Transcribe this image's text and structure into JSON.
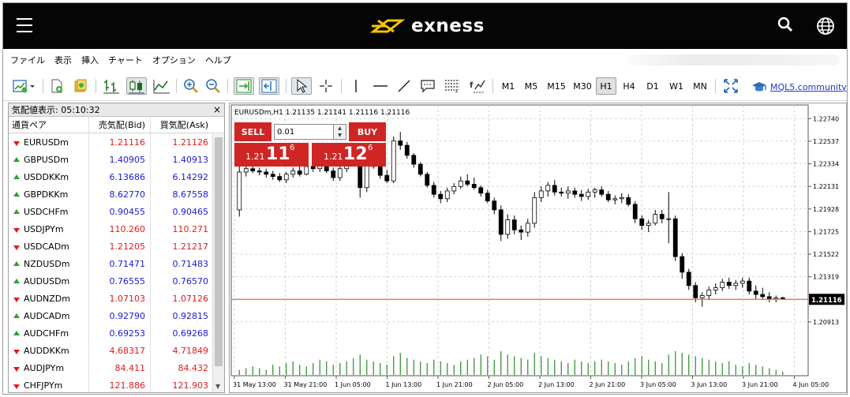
{
  "brand": {
    "name": "exness",
    "logo_color": "#f5c400"
  },
  "menu": [
    "ファイル",
    "表示",
    "挿入",
    "チャート",
    "オプション",
    "ヘルプ"
  ],
  "toolbar": {
    "timeframes": [
      "M1",
      "M5",
      "M15",
      "M30",
      "H1",
      "H4",
      "D1",
      "W1",
      "MN"
    ],
    "active_timeframe": "H1",
    "community_label": "MQL5.community"
  },
  "market_watch": {
    "title": "気配値表示: 05:10:32",
    "columns": {
      "symbol": "通貨ペア",
      "bid": "売気配(Bid)",
      "ask": "買気配(Ask)"
    },
    "rows": [
      {
        "symbol": "EURUSDm",
        "bid": "1.21116",
        "ask": "1.21126",
        "dir": "down"
      },
      {
        "symbol": "GBPUSDm",
        "bid": "1.40905",
        "ask": "1.40913",
        "dir": "up"
      },
      {
        "symbol": "USDDKKm",
        "bid": "6.13686",
        "ask": "6.14292",
        "dir": "up"
      },
      {
        "symbol": "GBPDKKm",
        "bid": "8.62770",
        "ask": "8.67558",
        "dir": "up"
      },
      {
        "symbol": "USDCHFm",
        "bid": "0.90455",
        "ask": "0.90465",
        "dir": "up"
      },
      {
        "symbol": "USDJPYm",
        "bid": "110.260",
        "ask": "110.271",
        "dir": "down"
      },
      {
        "symbol": "USDCADm",
        "bid": "1.21205",
        "ask": "1.21217",
        "dir": "down"
      },
      {
        "symbol": "NZDUSDm",
        "bid": "0.71471",
        "ask": "0.71483",
        "dir": "up"
      },
      {
        "symbol": "AUDUSDm",
        "bid": "0.76555",
        "ask": "0.76570",
        "dir": "up"
      },
      {
        "symbol": "AUDNZDm",
        "bid": "1.07103",
        "ask": "1.07126",
        "dir": "down"
      },
      {
        "symbol": "AUDCADm",
        "bid": "0.92790",
        "ask": "0.92815",
        "dir": "up"
      },
      {
        "symbol": "AUDCHFm",
        "bid": "0.69253",
        "ask": "0.69268",
        "dir": "up"
      },
      {
        "symbol": "AUDDKKm",
        "bid": "4.68317",
        "ask": "4.71849",
        "dir": "down"
      },
      {
        "symbol": "AUDJPYm",
        "bid": "84.411",
        "ask": "84.432",
        "dir": "down"
      },
      {
        "symbol": "CHFJPYm",
        "bid": "121.886",
        "ask": "121.903",
        "dir": "down"
      }
    ]
  },
  "trade_panel": {
    "sell_label": "SELL",
    "buy_label": "BUY",
    "lot": "0.01",
    "sell_price": {
      "prefix": "1.21",
      "big": "11",
      "sup": "6"
    },
    "buy_price": {
      "prefix": "1.21",
      "big": "12",
      "sup": "6"
    }
  },
  "chart_data": {
    "type": "candlestick",
    "title": "EURUSDm,H1  1.21135 1.21141 1.21116 1.21116",
    "current_price": 1.21116,
    "current_price_label": "1.21116",
    "ylim": [
      1.2082,
      1.2282
    ],
    "y_ticks": [
      "1.22740",
      "1.22537",
      "1.22334",
      "1.22131",
      "1.21928",
      "1.21725",
      "1.21522",
      "1.21319",
      "1.20913"
    ],
    "x_ticks": [
      "31 May 13:00",
      "31 May 21:00",
      "1 Jun 05:00",
      "1 Jun 13:00",
      "1 Jun 21:00",
      "2 Jun 05:00",
      "2 Jun 13:00",
      "2 Jun 21:00",
      "3 Jun 05:00",
      "3 Jun 13:00",
      "3 Jun 21:00",
      "4 Jun 05:00"
    ],
    "colors": {
      "bull": "#ffffff",
      "bear": "#000000",
      "wick": "#000000",
      "volume": "#2a8a2a",
      "price_line": "#e87a3c",
      "grid": "#c8c8c8"
    },
    "ohlc": [
      [
        1.2192,
        1.2235,
        1.2186,
        1.2226
      ],
      [
        1.2226,
        1.2232,
        1.2222,
        1.2229
      ],
      [
        1.2229,
        1.2231,
        1.2225,
        1.2227
      ],
      [
        1.2227,
        1.223,
        1.2223,
        1.2226
      ],
      [
        1.2226,
        1.2229,
        1.2221,
        1.2224
      ],
      [
        1.2224,
        1.2227,
        1.2219,
        1.2222
      ],
      [
        1.2222,
        1.2225,
        1.2217,
        1.2219
      ],
      [
        1.2219,
        1.2226,
        1.2216,
        1.2224
      ],
      [
        1.2224,
        1.223,
        1.2221,
        1.2227
      ],
      [
        1.2227,
        1.2231,
        1.2222,
        1.2224
      ],
      [
        1.2224,
        1.2233,
        1.2223,
        1.2231
      ],
      [
        1.2231,
        1.2234,
        1.2226,
        1.2229
      ],
      [
        1.2229,
        1.2234,
        1.2226,
        1.2232
      ],
      [
        1.2232,
        1.2234,
        1.2225,
        1.2227
      ],
      [
        1.2227,
        1.223,
        1.2218,
        1.2221
      ],
      [
        1.2221,
        1.2232,
        1.2218,
        1.2229
      ],
      [
        1.2229,
        1.224,
        1.2226,
        1.2237
      ],
      [
        1.2237,
        1.2245,
        1.2232,
        1.2235
      ],
      [
        1.2235,
        1.2241,
        1.2203,
        1.2212
      ],
      [
        1.2212,
        1.224,
        1.2208,
        1.2237
      ],
      [
        1.2237,
        1.2248,
        1.2229,
        1.2231
      ],
      [
        1.2231,
        1.2236,
        1.222,
        1.2223
      ],
      [
        1.2223,
        1.2228,
        1.2216,
        1.2218
      ],
      [
        1.2218,
        1.2258,
        1.2216,
        1.2254
      ],
      [
        1.2254,
        1.2262,
        1.2246,
        1.225
      ],
      [
        1.225,
        1.2253,
        1.2238,
        1.2241
      ],
      [
        1.2241,
        1.2243,
        1.223,
        1.2233
      ],
      [
        1.2233,
        1.2235,
        1.2222,
        1.2224
      ],
      [
        1.2224,
        1.2226,
        1.2212,
        1.2214
      ],
      [
        1.2214,
        1.2217,
        1.2203,
        1.2206
      ],
      [
        1.2206,
        1.2209,
        1.2198,
        1.2202
      ],
      [
        1.2202,
        1.2212,
        1.2199,
        1.2209
      ],
      [
        1.2209,
        1.2216,
        1.2206,
        1.2213
      ],
      [
        1.2213,
        1.2222,
        1.2211,
        1.2218
      ],
      [
        1.2218,
        1.2224,
        1.2213,
        1.2215
      ],
      [
        1.2215,
        1.2221,
        1.221,
        1.2212
      ],
      [
        1.2212,
        1.2214,
        1.2204,
        1.2207
      ],
      [
        1.2207,
        1.221,
        1.2198,
        1.22
      ],
      [
        1.22,
        1.2203,
        1.2188,
        1.2192
      ],
      [
        1.2192,
        1.2196,
        1.2164,
        1.217
      ],
      [
        1.217,
        1.2188,
        1.2166,
        1.2183
      ],
      [
        1.2183,
        1.2187,
        1.217,
        1.2174
      ],
      [
        1.2174,
        1.2178,
        1.2165,
        1.2172
      ],
      [
        1.2172,
        1.2184,
        1.2168,
        1.218
      ],
      [
        1.218,
        1.2208,
        1.2176,
        1.2203
      ],
      [
        1.2203,
        1.2213,
        1.2199,
        1.2209
      ],
      [
        1.2209,
        1.2217,
        1.2204,
        1.2214
      ],
      [
        1.2214,
        1.2219,
        1.2205,
        1.2208
      ],
      [
        1.2208,
        1.2212,
        1.2204,
        1.2207
      ],
      [
        1.2207,
        1.2213,
        1.2202,
        1.2209
      ],
      [
        1.2209,
        1.2212,
        1.2203,
        1.2206
      ],
      [
        1.2206,
        1.221,
        1.22,
        1.2204
      ],
      [
        1.2204,
        1.2211,
        1.2201,
        1.2208
      ],
      [
        1.2208,
        1.2212,
        1.2203,
        1.221
      ],
      [
        1.221,
        1.2213,
        1.2204,
        1.2206
      ],
      [
        1.2206,
        1.2209,
        1.2199,
        1.2201
      ],
      [
        1.2201,
        1.2205,
        1.2197,
        1.2202
      ],
      [
        1.2202,
        1.2207,
        1.2198,
        1.2203
      ],
      [
        1.2203,
        1.2206,
        1.2195,
        1.2197
      ],
      [
        1.2197,
        1.22,
        1.218,
        1.2184
      ],
      [
        1.2184,
        1.2187,
        1.2174,
        1.2178
      ],
      [
        1.2178,
        1.2183,
        1.2172,
        1.218
      ],
      [
        1.218,
        1.2192,
        1.2178,
        1.2188
      ],
      [
        1.2188,
        1.2192,
        1.218,
        1.2184
      ],
      [
        1.2184,
        1.2208,
        1.2162,
        1.2184
      ],
      [
        1.2184,
        1.2187,
        1.2146,
        1.215
      ],
      [
        1.215,
        1.2153,
        1.213,
        1.2136
      ],
      [
        1.2136,
        1.2139,
        1.212,
        1.2124
      ],
      [
        1.2124,
        1.2127,
        1.2109,
        1.2113
      ],
      [
        1.2113,
        1.2118,
        1.2105,
        1.2115
      ],
      [
        1.2115,
        1.2123,
        1.2111,
        1.212
      ],
      [
        1.212,
        1.2126,
        1.2116,
        1.2122
      ],
      [
        1.2122,
        1.213,
        1.2119,
        1.2127
      ],
      [
        1.2127,
        1.2131,
        1.2121,
        1.2124
      ],
      [
        1.2124,
        1.2129,
        1.212,
        1.2126
      ],
      [
        1.2126,
        1.2131,
        1.2122,
        1.2128
      ],
      [
        1.2128,
        1.2131,
        1.2116,
        1.2119
      ],
      [
        1.2119,
        1.2124,
        1.2112,
        1.2116
      ],
      [
        1.2116,
        1.2122,
        1.2111,
        1.2114
      ],
      [
        1.2114,
        1.2118,
        1.2109,
        1.2112
      ],
      [
        1.2112,
        1.2115,
        1.2109,
        1.2113
      ],
      [
        1.2113,
        1.2114,
        1.2111,
        1.2112
      ]
    ],
    "volume": [
      3,
      4,
      5,
      4,
      3,
      6,
      5,
      7,
      8,
      6,
      5,
      7,
      9,
      8,
      6,
      7,
      8,
      10,
      12,
      9,
      8,
      7,
      6,
      11,
      13,
      10,
      9,
      8,
      7,
      9,
      8,
      7,
      6,
      8,
      9,
      10,
      12,
      11,
      9,
      14,
      12,
      11,
      10,
      9,
      13,
      11,
      10,
      9,
      8,
      7,
      9,
      8,
      7,
      8,
      9,
      8,
      7,
      6,
      8,
      10,
      11,
      9,
      8,
      7,
      12,
      14,
      13,
      12,
      11,
      10,
      9,
      8,
      7,
      8,
      6,
      5,
      7,
      6,
      5,
      4,
      3,
      2
    ]
  }
}
